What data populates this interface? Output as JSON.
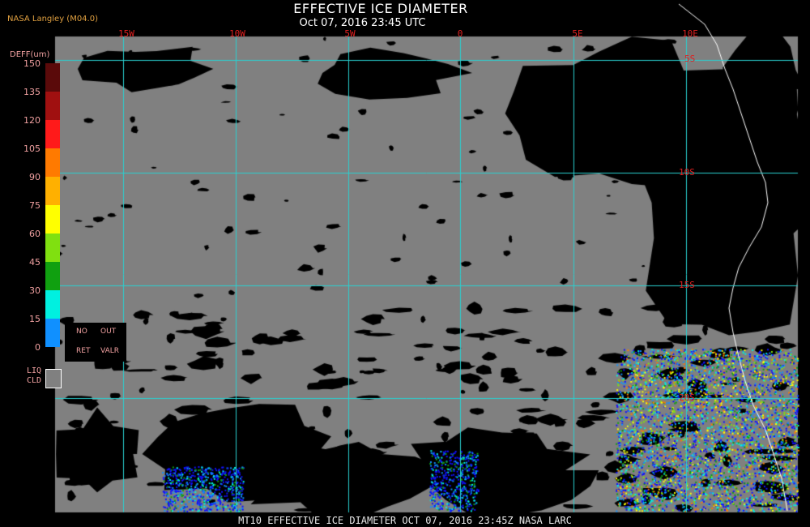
{
  "header": {
    "title": "EFFECTIVE ICE DIAMETER",
    "subtitle": "Oct 07, 2016 23:45 UTC",
    "badge": "NASA Langley (M04.0)"
  },
  "map": {
    "background_color": "#808080",
    "clear_color": "#000000",
    "grid_color": "#2ad0d0",
    "coastline_color": "#ffffff",
    "longitude_labels": [
      "15W",
      "10W",
      "5W",
      "0",
      "5E",
      "10E"
    ],
    "latitude_labels": [
      "5S",
      "10S",
      "15S",
      "20S"
    ]
  },
  "legend": {
    "title": "DEFF(um)",
    "ticks": [
      "150",
      "135",
      "120",
      "105",
      "90",
      "75",
      "60",
      "45",
      "30",
      "15",
      "0"
    ],
    "colors": [
      "#5a0a0a",
      "#a01010",
      "#ff1a1a",
      "#ff7a00",
      "#ffb000",
      "#ffff00",
      "#80e010",
      "#10a010",
      "#00f0e0",
      "#1090ff",
      "#1010ff",
      "#8030e0"
    ],
    "no_retrieval": {
      "line1": [
        "NO",
        "OUT"
      ],
      "line2": [
        "RET",
        "VALR"
      ]
    },
    "liquid_cloud": {
      "label_line1": "LIQ",
      "label_line2": "CLD"
    }
  },
  "footer": "MT10  EFFECTIVE ICE DIAMETER   OCT 07, 2016 23:45Z   NASA LARC"
}
